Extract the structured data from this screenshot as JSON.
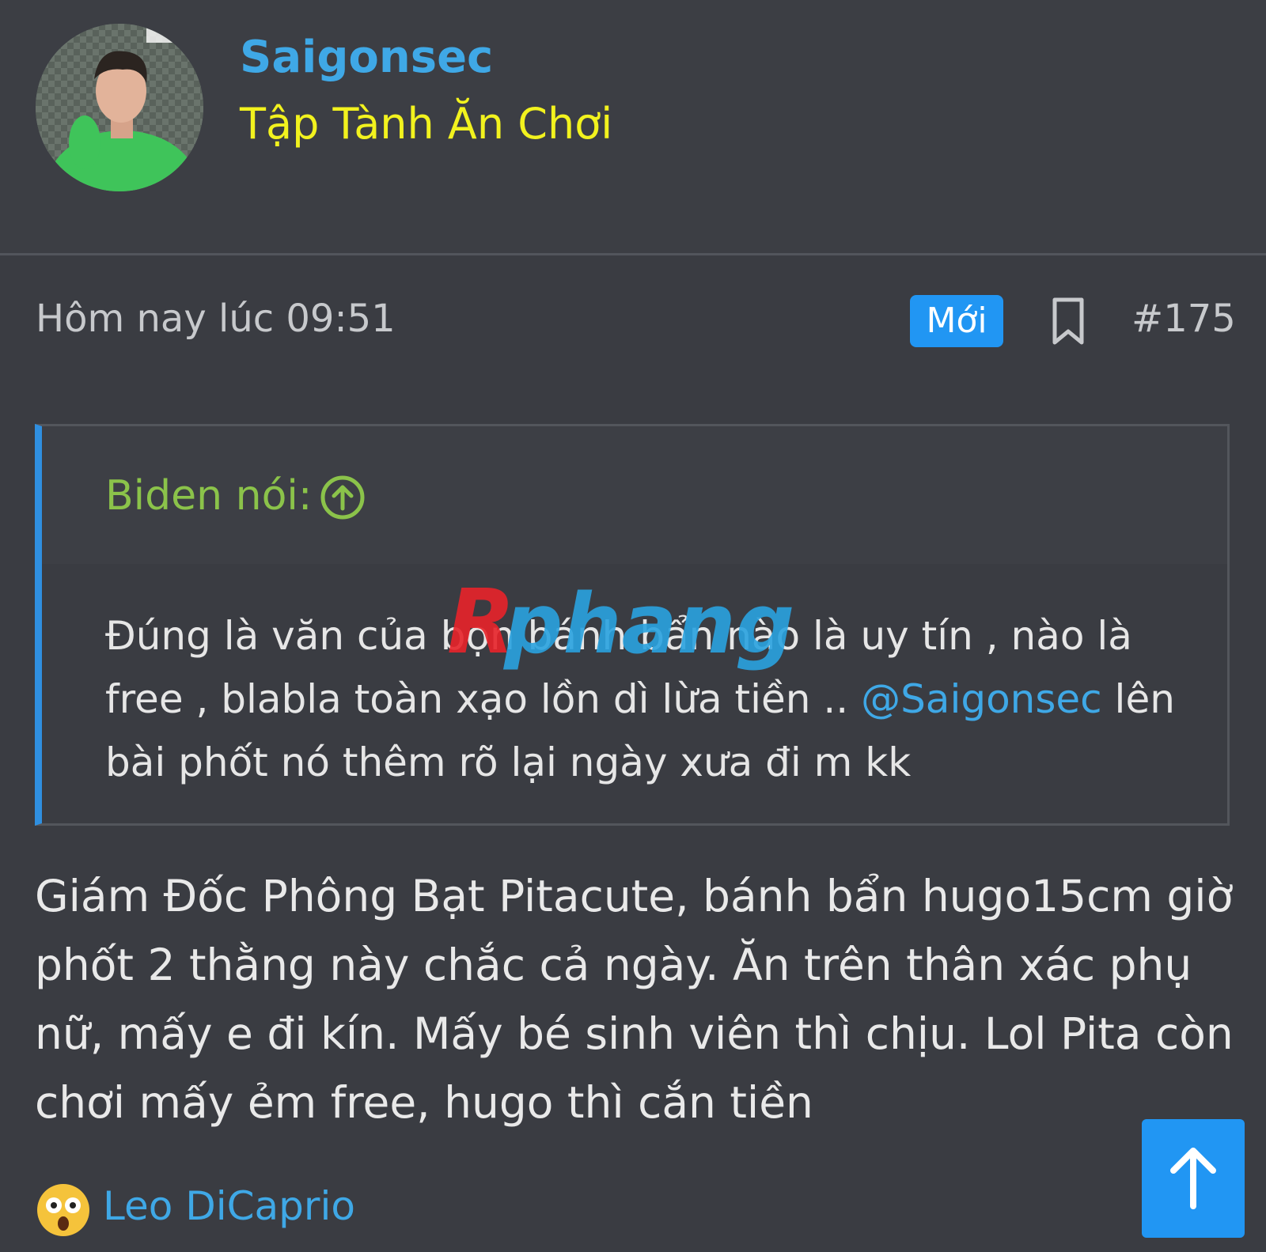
{
  "user": {
    "name": "Saigonsec",
    "title": "Tập Tành Ăn Chơi"
  },
  "post": {
    "date": "Hôm nay lúc 09:51",
    "badge": "Mới",
    "number": "#175",
    "body": "Giám Đốc Phông Bạt Pitacute, bánh bẩn hugo15cm giờ phốt 2 thằng này chắc cả ngày. Ăn trên thân xác phụ nữ, mấy e đi kín. Mấy bé sinh viên thì chịu. Lol Pita còn chơi mấy ẻm free, hugo thì cắn tiền"
  },
  "quote": {
    "author": "Biden nói:",
    "text_before": "Đúng là văn của bọn bánh bẩn nào là uy tín , nào là free , blabla toàn xạo lồn dì lừa tiền .. ",
    "mention": "@Saigonsec",
    "text_after": " lên bài phốt nó thêm rõ lại ngày xưa đi m kk"
  },
  "watermark": "Rphang",
  "reaction": {
    "emoji": "astonished-face-emoji",
    "user": "Leo DiCaprio"
  },
  "colors": {
    "background": "#3a3c42",
    "username": "#3fa8e6",
    "user_title": "#f2f21e",
    "badge": "#2196f3",
    "quote_border": "#2f8fe0",
    "quote_author": "#8bc34a"
  },
  "icons": {
    "bookmark": "bookmark-icon",
    "expand": "arrow-up-circle-icon",
    "scroll_top": "arrow-up-icon"
  }
}
